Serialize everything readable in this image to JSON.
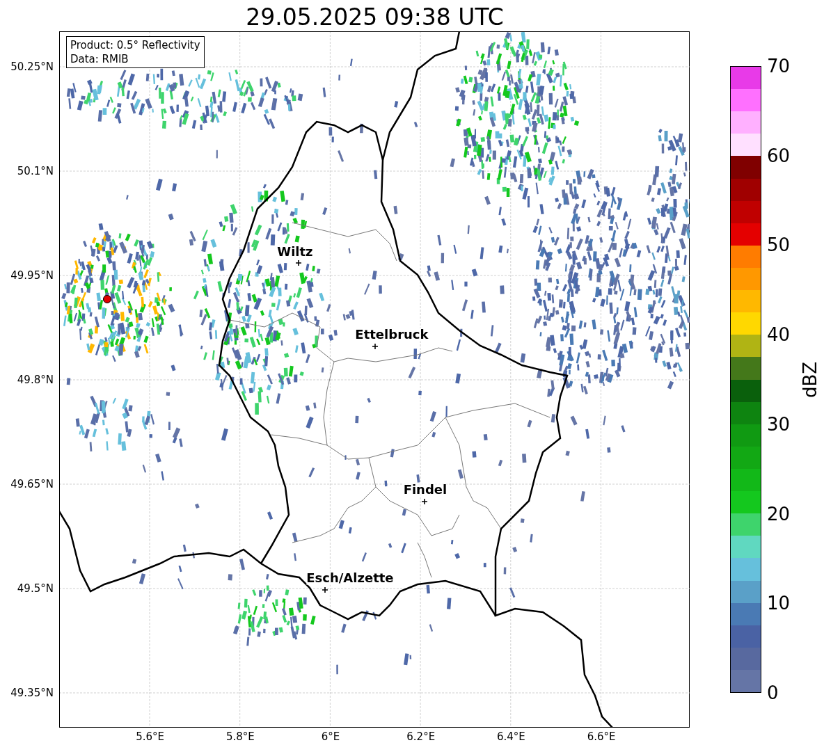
{
  "title": "29.05.2025 09:38 UTC",
  "info_box": {
    "lines": [
      "Product: 0.5° Reflectivity",
      "Data: RMIB"
    ]
  },
  "cities": [
    {
      "label": "Wiltz"
    },
    {
      "label": "Ettelbruck"
    },
    {
      "label": "Findel"
    },
    {
      "label": "Esch/Alzette"
    }
  ],
  "axes": {
    "yticks": [
      "50.25°N",
      "50.1°N",
      "49.95°N",
      "49.8°N",
      "49.65°N",
      "49.5°N",
      "49.35°N"
    ],
    "xticks": [
      "5.6°E",
      "5.8°E",
      "6°E",
      "6.2°E",
      "6.4°E",
      "6.6°E"
    ]
  },
  "colorbar": {
    "label": "dBZ",
    "ticks": [
      "70",
      "60",
      "50",
      "40",
      "30",
      "20",
      "10",
      "0"
    ],
    "segments": [
      {
        "color": "#e83ae8"
      },
      {
        "color": "#ff70ff"
      },
      {
        "color": "#ffb0ff"
      },
      {
        "color": "#ffe0ff"
      },
      {
        "color": "#800000"
      },
      {
        "color": "#a00000"
      },
      {
        "color": "#c00000"
      },
      {
        "color": "#e40000"
      },
      {
        "color": "#ff7c00"
      },
      {
        "color": "#ff9800"
      },
      {
        "color": "#ffb800"
      },
      {
        "color": "#ffd800"
      },
      {
        "color": "#b0b414"
      },
      {
        "color": "#44781a"
      },
      {
        "color": "#0a600c"
      },
      {
        "color": "#0e8410"
      },
      {
        "color": "#109a12"
      },
      {
        "color": "#12a814"
      },
      {
        "color": "#12b818"
      },
      {
        "color": "#14c81e"
      },
      {
        "color": "#3ed46c"
      },
      {
        "color": "#60d8c0"
      },
      {
        "color": "#66c0dc"
      },
      {
        "color": "#5aa0c8"
      },
      {
        "color": "#4a7ab4"
      },
      {
        "color": "#4a62a4"
      },
      {
        "color": "#58699f"
      },
      {
        "color": "#6575a6"
      }
    ]
  }
}
